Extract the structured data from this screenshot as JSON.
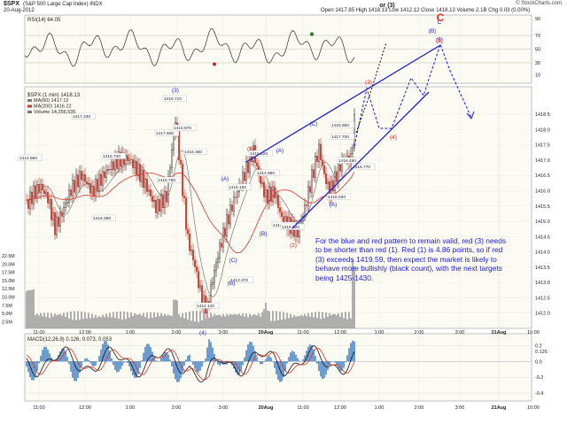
{
  "header": {
    "symbol": "$SPX",
    "name": "(S&P 500 Large Cap Index) INDX",
    "date": "20-Aug-2012",
    "quote": "Open 1417.85   High 1418.13   Low 1412.12   Close 1418.13   Volume 2.1B   Chg 0.03 (0.00%)",
    "brand": "© StockCharts.com"
  },
  "chart_data": [
    {
      "type": "line",
      "panel": "rsi",
      "title": "RSI(14) 64.05",
      "ylim": [
        0,
        100
      ],
      "y_ticks": [
        "70",
        "50",
        "30"
      ],
      "band": [
        30,
        70
      ]
    },
    {
      "type": "candlestick",
      "panel": "price",
      "title": "$SPX (1 min) 1418.13",
      "ylim": [
        1411.5,
        1419.4
      ],
      "y_ticks": [
        "1418.5",
        "1418.0",
        "1417.5",
        "1417.0",
        "1416.5",
        "1416.0",
        "1415.5",
        "1415.0",
        "1414.5",
        "1414.0",
        "1413.5",
        "1413.0",
        "1412.5",
        "1412.0"
      ],
      "volume_ticks": [
        "22.5M",
        "20.0M",
        "17.5M",
        "15.0M",
        "12.5M",
        "10.0M",
        "7.5M",
        "5.0M",
        "2.5M"
      ],
      "series": [
        {
          "name": "MA(60) 1417.12",
          "color": "#777777"
        },
        {
          "name": "MA(200) 1416.22",
          "color": "#d9362a"
        },
        {
          "name": "Volume 14,256,535",
          "color": "#777777"
        }
      ],
      "price_labels": [
        "1417.330",
        "1417.600",
        "1416.970",
        "1415.730",
        "1414.860",
        "1416.360",
        "1415.780",
        "1418.710",
        "1416.390",
        "1415.150",
        "1413.370",
        "1412.140",
        "1415.820",
        "1414.980",
        "1416.690",
        "1414.710",
        "1416.020",
        "1417.700",
        "1415.930",
        "1416.480",
        "1416.770"
      ],
      "waves_blue": [
        "(3)",
        "(4)",
        "(A)",
        "(B)",
        "(C)",
        "(A)",
        "(B)",
        "(C)",
        "(A)",
        "(B)",
        "C",
        "(5)"
      ],
      "waves_red": [
        "(1)",
        "(2)",
        "(3)",
        "(4)",
        "(5)"
      ],
      "wave_alt": "or (3)",
      "wave_big": "C"
    },
    {
      "type": "line",
      "panel": "macd",
      "title": "MACD(12,26,9) 0.126, 0.073, 0.053",
      "y_ticks": [
        "0.2",
        "0.126",
        "0.0",
        "-0.2",
        "-0.4"
      ]
    }
  ],
  "x_axis": [
    "11:00",
    "12:00",
    "1:00",
    "2:00",
    "3:00",
    "20Aug",
    "11:00",
    "12:00",
    "1:00",
    "2:00",
    "3:00",
    "21Aug",
    "10:00",
    "11:00",
    "12:00",
    "1:00",
    "2:00",
    "3:00",
    "22Aug"
  ],
  "annotation": "For the blue and red pattern to remain valid, red (3) needs to be shorter than red (1).  Red (1) is 4.86 points, so if red (3) exceeds 1419.59, then expect the market is likely to behave more bullishly (black count), with the next targets being 1425-1430.",
  "colors": {
    "up": "#1d1d1d",
    "down": "#d9362a",
    "wave": "#1c1cd6",
    "red": "#e8281c",
    "panel": "#fbfbf3"
  }
}
